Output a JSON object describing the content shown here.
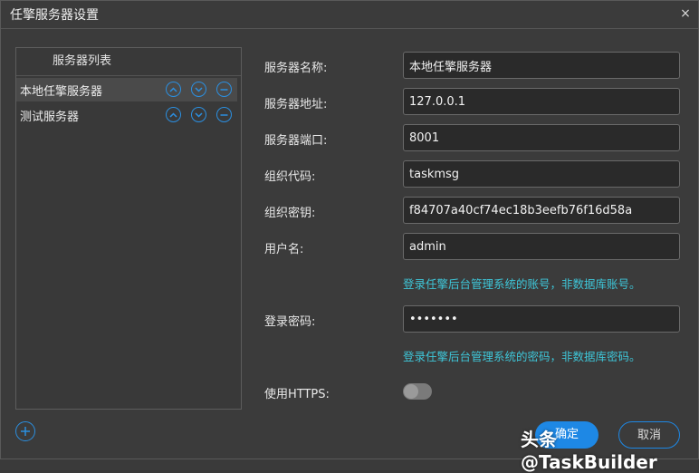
{
  "window": {
    "title": "任擎服务器设置",
    "close_icon": "×"
  },
  "server_list": {
    "header": "服务器列表",
    "items": [
      {
        "label": "本地任擎服务器",
        "selected": true
      },
      {
        "label": "测试服务器",
        "selected": false
      }
    ]
  },
  "form": {
    "server_name": {
      "label": "服务器名称:",
      "value": "本地任擎服务器"
    },
    "server_address": {
      "label": "服务器地址:",
      "value": "127.0.0.1"
    },
    "server_port": {
      "label": "服务器端口:",
      "value": "8001"
    },
    "org_code": {
      "label": "组织代码:",
      "value": "taskmsg"
    },
    "org_secret": {
      "label": "组织密钥:",
      "value": "f84707a40cf74ec18b3eefb76f16d58a"
    },
    "username": {
      "label": "用户名:",
      "value": "admin",
      "hint": "登录任擎后台管理系统的账号，非数据库账号。"
    },
    "password": {
      "label": "登录密码:",
      "value": "•••••••",
      "hint": "登录任擎后台管理系统的密码，非数据库密码。"
    },
    "https": {
      "label": "使用HTTPS:",
      "enabled": false
    }
  },
  "footer": {
    "ok_label": "确定",
    "cancel_label": "取消"
  },
  "watermark": "头条 @TaskBuilder",
  "colors": {
    "accent": "#1e88e5",
    "hint": "#3ec6d8",
    "background": "#3b3b3b"
  }
}
